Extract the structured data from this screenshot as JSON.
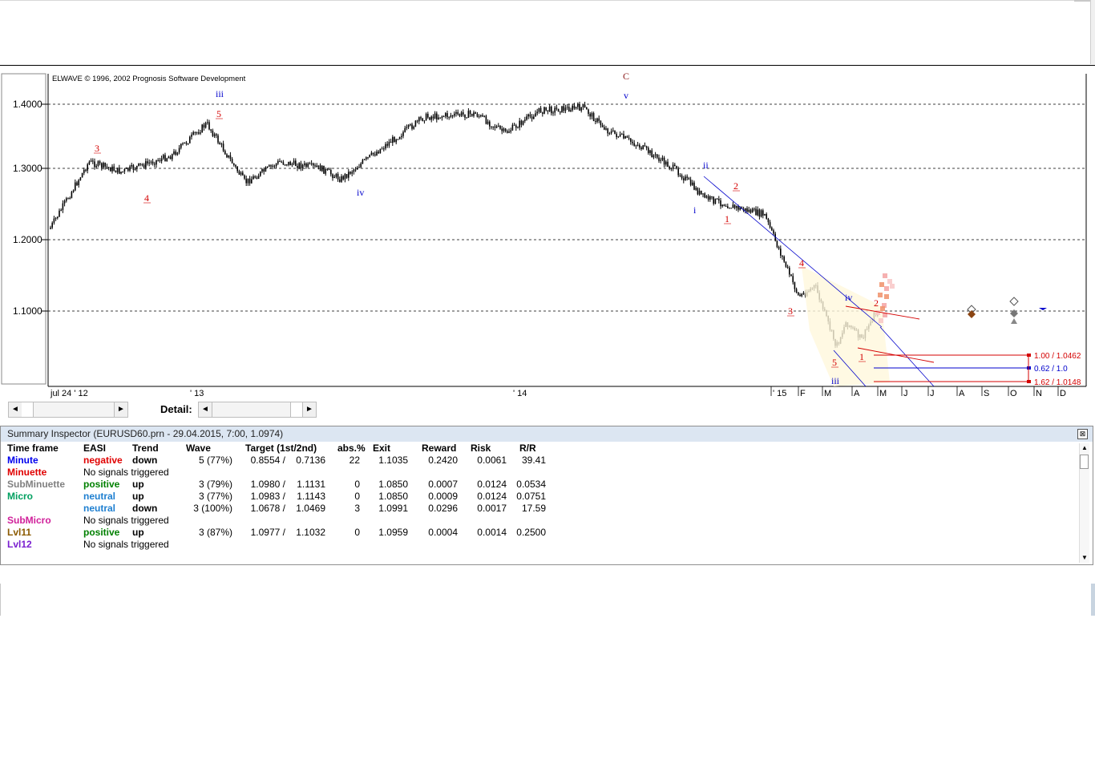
{
  "chart": {
    "copyright": "ELWAVE © 1996, 2002 Prognosis Software Development",
    "y_tick_labels": [
      "1.4000",
      "1.3000",
      "1.2000",
      "1.1000"
    ],
    "x_tick_labels": [
      "jul 24 ' 12",
      "' 13",
      "' 14",
      "' 15",
      "F",
      "M",
      "A",
      "M",
      "J",
      "J",
      "A",
      "S",
      "O",
      "N",
      "D"
    ],
    "wave_labels": [
      {
        "text": "3",
        "color": "#d40000"
      },
      {
        "text": "4",
        "color": "#d40000"
      },
      {
        "text": "iii",
        "color": "#0000cc"
      },
      {
        "text": "5",
        "color": "#d40000"
      },
      {
        "text": "iv",
        "color": "#0000cc"
      },
      {
        "text": "C",
        "color": "#8b1a1a"
      },
      {
        "text": "v",
        "color": "#0000cc"
      },
      {
        "text": "ii",
        "color": "#0000cc"
      },
      {
        "text": "i",
        "color": "#0000cc"
      },
      {
        "text": "2",
        "color": "#d40000"
      },
      {
        "text": "1",
        "color": "#d40000"
      },
      {
        "text": "4",
        "color": "#d40000"
      },
      {
        "text": "3",
        "color": "#d40000"
      },
      {
        "text": "iv",
        "color": "#0000cc"
      },
      {
        "text": "5",
        "color": "#d40000"
      },
      {
        "text": "iii",
        "color": "#0000cc"
      },
      {
        "text": "2",
        "color": "#d40000"
      },
      {
        "text": "1",
        "color": "#d40000"
      }
    ],
    "target_labels": [
      "1.00 / 1.0462",
      "0.62 / 1.0",
      "1.62 / 1.0148"
    ],
    "target_colors": [
      "#d40000",
      "#0000cc",
      "#d40000"
    ]
  },
  "chart_data": {
    "type": "candlestick",
    "title": "",
    "symbol": "EURUSD",
    "ylim": [
      1.04,
      1.41
    ],
    "yticks": [
      1.4,
      1.3,
      1.2,
      1.1
    ],
    "grid": "horizontal dashed",
    "series": [
      {
        "x": [
          "2012-07-24",
          "2012-09-10",
          "2012-10-20",
          "2012-12-20",
          "2013-02-01",
          "2013-03-20",
          "2013-05-01",
          "2013-06-20",
          "2013-07-15",
          "2013-09-01",
          "2013-10-25",
          "2013-12-27",
          "2014-02-01",
          "2014-03-15",
          "2014-05-07",
          "2014-06-05",
          "2014-07-15",
          "2014-09-01",
          "2014-10-01",
          "2014-11-10",
          "2014-12-15",
          "2015-01-26",
          "2015-02-15",
          "2015-03-13",
          "2015-03-25",
          "2015-04-13",
          "2015-04-29"
        ],
        "close": [
          1.215,
          1.31,
          1.295,
          1.32,
          1.37,
          1.28,
          1.31,
          1.3,
          1.285,
          1.33,
          1.38,
          1.385,
          1.355,
          1.39,
          1.395,
          1.36,
          1.335,
          1.295,
          1.26,
          1.245,
          1.235,
          1.12,
          1.135,
          1.05,
          1.085,
          1.06,
          1.097
        ]
      }
    ]
  },
  "navigation": {
    "detail_label": "Detail:",
    "left_arrow": "◄",
    "right_arrow": "►"
  },
  "inspector": {
    "title": "Summary Inspector (EURUSD60.prn - 29.04.2015, 7:00, 1.0974)",
    "close_glyph": "⊠",
    "headers": [
      "Time frame",
      "EASI",
      "Trend",
      "Wave",
      "Target (1st/2nd)",
      "abs.%",
      "Exit",
      "Reward",
      "Risk",
      "R/R"
    ],
    "rows": [
      {
        "tf": "Minute",
        "tf_color": "#0000ee",
        "easi": "negative",
        "easi_color": "#e00000",
        "trend": "down",
        "wave": "5 (77%)",
        "t1": "0.8554 /",
        "t2": "0.7136",
        "abs": "22",
        "exit": "1.1035",
        "reward": "0.2420",
        "risk": "0.0061",
        "rr": "39.41"
      },
      {
        "tf": "Minuette",
        "tf_color": "#e00000",
        "msg": "No signals triggered"
      },
      {
        "tf": "SubMinuette",
        "tf_color": "#808080",
        "easi": "positive",
        "easi_color": "#008000",
        "trend": "up",
        "wave": "3 (79%)",
        "t1": "1.0980 /",
        "t2": "1.1131",
        "abs": "0",
        "exit": "1.0850",
        "reward": "0.0007",
        "risk": "0.0124",
        "rr": "0.0534"
      },
      {
        "tf": "Micro",
        "tf_color": "#00a060",
        "easi": "neutral",
        "easi_color": "#1e7fd0",
        "trend": "up",
        "wave": "3 (77%)",
        "t1": "1.0983 /",
        "t2": "1.1143",
        "abs": "0",
        "exit": "1.0850",
        "reward": "0.0009",
        "risk": "0.0124",
        "rr": "0.0751"
      },
      {
        "tf": "",
        "tf_color": "#000000",
        "easi": "neutral",
        "easi_color": "#1e7fd0",
        "trend": "down",
        "wave": "3 (100%)",
        "t1": "1.0678 /",
        "t2": "1.0469",
        "abs": "3",
        "exit": "1.0991",
        "reward": "0.0296",
        "risk": "0.0017",
        "rr": "17.59"
      },
      {
        "tf": "SubMicro",
        "tf_color": "#d0209a",
        "msg": "No signals triggered"
      },
      {
        "tf": "Lvl11",
        "tf_color": "#8b5a00",
        "easi": "positive",
        "easi_color": "#008000",
        "trend": "up",
        "wave": "3 (87%)",
        "t1": "1.0977 /",
        "t2": "1.1032",
        "abs": "0",
        "exit": "1.0959",
        "reward": "0.0004",
        "risk": "0.0014",
        "rr": "0.2500"
      },
      {
        "tf": "Lvl12",
        "tf_color": "#7a1fd0",
        "msg": "No signals triggered"
      }
    ]
  }
}
